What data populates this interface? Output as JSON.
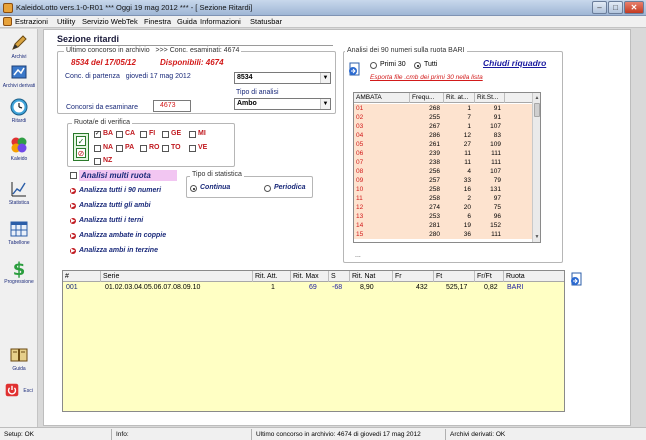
{
  "window": {
    "title": "KaleidoLotto vers.1-0-R01  ***  Oggi 19 mag 2012  ***  - [ Sezione Ritardi]",
    "minimize": "–",
    "maximize": "□",
    "close": "✕"
  },
  "menu": [
    "Estrazioni",
    "Utility",
    "Servizio WebTek",
    "Finestra",
    "Guida",
    "Informazioni",
    "Statusbar"
  ],
  "sidebar": {
    "archivi": "Archivi",
    "archivi_derivati": "Archivi derivati",
    "ritardi": "Ritardi",
    "kaleido": "Kaleido",
    "statistica": "Statistica",
    "tabellone": "Tabellone",
    "progressione": "Progressione",
    "guida": "Guida",
    "esci": "Esci"
  },
  "section_title": "Sezione ritardi",
  "archive": {
    "legend_left": "Ultimo concorso in archivio",
    "legend_right": ">>> Conc. esaminati: 4674",
    "last_contest": "8534 del 17/05/12",
    "available": "Disponibili: 4674",
    "start_label": "Conc. di partenza",
    "start_date": "giovedi 17 mag 2012",
    "start_value": "8534",
    "analysis_type_label": "Tipo di analisi",
    "analysis_type_value": "Ambo",
    "count_label": "Concorsi da esaminare",
    "count_value": "4673"
  },
  "ruote": {
    "legend": "Ruota/e di verifica",
    "items": [
      {
        "label": "BA",
        "checked": true
      },
      {
        "label": "CA",
        "checked": false
      },
      {
        "label": "FI",
        "checked": false
      },
      {
        "label": "GE",
        "checked": false
      },
      {
        "label": "MI",
        "checked": false
      },
      {
        "label": "NA",
        "checked": false
      },
      {
        "label": "PA",
        "checked": false
      },
      {
        "label": "RO",
        "checked": false
      },
      {
        "label": "TO",
        "checked": false
      },
      {
        "label": "VE",
        "checked": false
      },
      {
        "label": "NZ",
        "checked": false
      }
    ],
    "select_all": "✓",
    "deselect_all": "⊘"
  },
  "multi": "Analisi multi ruota",
  "stat_type": {
    "legend": "Tipo di statistica",
    "continua": "Continua",
    "periodica": "Periodica"
  },
  "actions": [
    "Analizza tutti i 90 numeri",
    "Analizza tutti gli ambi",
    "Analizza tutti i terni",
    "Analizza ambate in coppie",
    "Analizza ambi in terzine"
  ],
  "analysis90": {
    "legend": "Analisi dei 90 numeri sulla ruota BARI",
    "primi30": "Primi 30",
    "tutti": "Tutti",
    "close_link": "Chiudi riquadro",
    "export_link": "Esporta file .cmb dei primi 30 nella lista",
    "ellipsis": "...",
    "columns": [
      "AMBATA",
      "Frequ...",
      "Rit. at...",
      "Rit.St..."
    ],
    "rows": [
      [
        "01",
        "268",
        "1",
        "91"
      ],
      [
        "02",
        "255",
        "7",
        "91"
      ],
      [
        "03",
        "267",
        "1",
        "107"
      ],
      [
        "04",
        "286",
        "12",
        "83"
      ],
      [
        "05",
        "261",
        "27",
        "109"
      ],
      [
        "06",
        "239",
        "11",
        "111"
      ],
      [
        "07",
        "238",
        "11",
        "111"
      ],
      [
        "08",
        "256",
        "4",
        "107"
      ],
      [
        "09",
        "257",
        "33",
        "79"
      ],
      [
        "10",
        "258",
        "16",
        "131"
      ],
      [
        "11",
        "258",
        "2",
        "97"
      ],
      [
        "12",
        "274",
        "20",
        "75"
      ],
      [
        "13",
        "253",
        "6",
        "96"
      ],
      [
        "14",
        "281",
        "19",
        "152"
      ],
      [
        "15",
        "280",
        "36",
        "111"
      ]
    ]
  },
  "grid": {
    "columns": [
      "#",
      "Serie",
      "Rit. Att.",
      "Rit. Max",
      "S",
      "Rit. Nat",
      "Fr",
      "Ft",
      "Fr/Ft",
      "Ruota"
    ],
    "rows": [
      [
        "001",
        "01.02.03.04.05.06.07.08.09.10",
        "1",
        "69",
        "-68",
        "8,90",
        "432",
        "525,17",
        "0,82",
        "BARI"
      ]
    ]
  },
  "status": {
    "setup": "Setup: OK",
    "info": "Info:",
    "last": "Ultimo concorso in archivio: 4674 di giovedi 17 mag 2012",
    "derived": "Archivi derivati: OK"
  },
  "colors": {
    "accent_red": "#d21a1a",
    "navy": "#1a2a7a",
    "table_row": "#fde3cf",
    "grid_bg": "#ffffc4"
  }
}
